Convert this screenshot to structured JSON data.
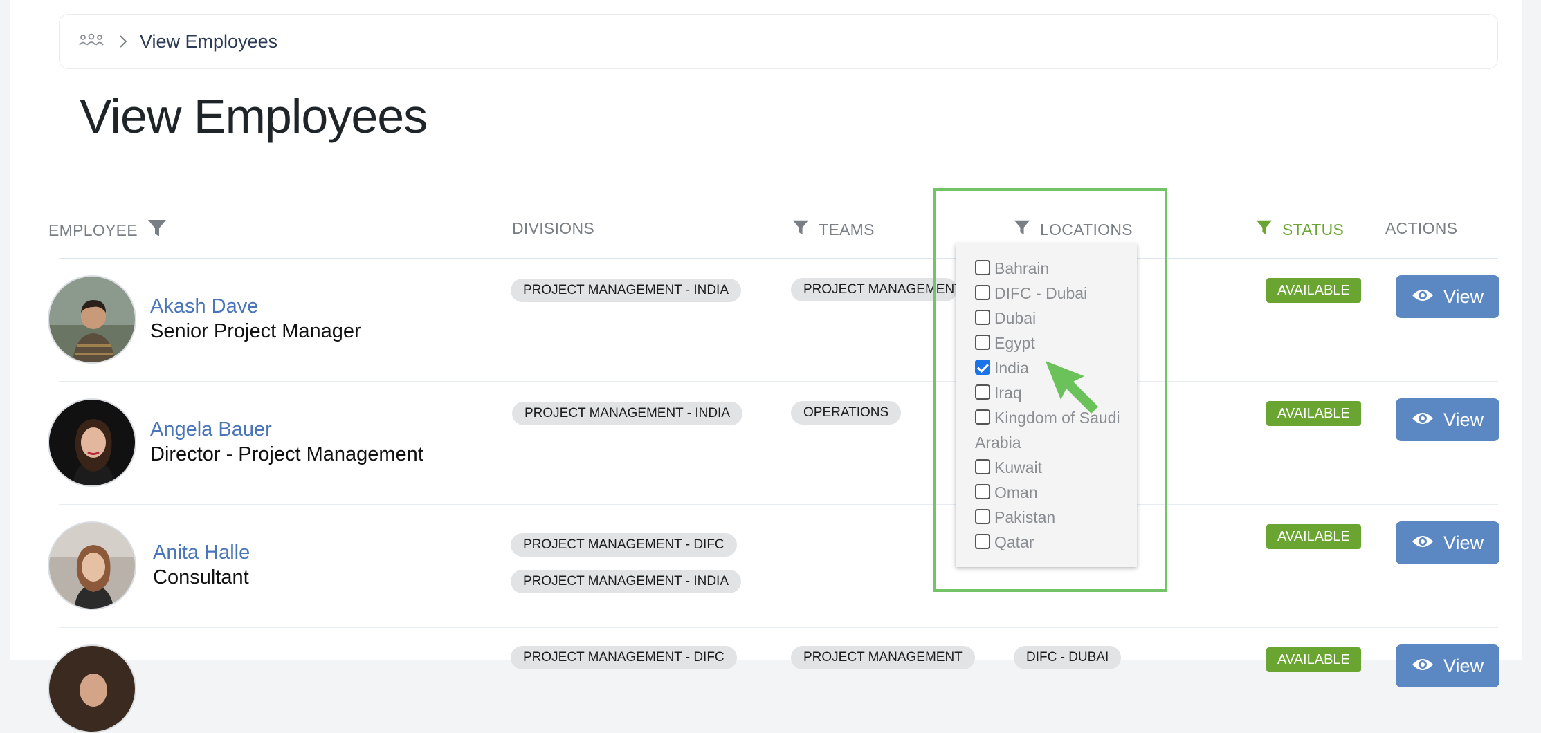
{
  "breadcrumb": {
    "current": "View Employees"
  },
  "page": {
    "title": "View Employees"
  },
  "columns": {
    "employee": "EMPLOYEE",
    "divisions": "DIVISIONS",
    "teams": "TEAMS",
    "locations": "LOCATIONS",
    "status": "STATUS",
    "actions": "ACTIONS"
  },
  "employees": [
    {
      "name": "Akash Dave",
      "title": "Senior Project Manager",
      "divisions": [
        "PROJECT MANAGEMENT - INDIA"
      ],
      "teams": [
        "PROJECT MANAGEMENT"
      ],
      "status": "AVAILABLE",
      "action": "View"
    },
    {
      "name": "Angela Bauer",
      "title": "Director - Project Management",
      "divisions": [
        "PROJECT MANAGEMENT - INDIA"
      ],
      "teams": [
        "OPERATIONS"
      ],
      "status": "AVAILABLE",
      "action": "View"
    },
    {
      "name": "Anita Halle",
      "title": "Consultant",
      "divisions": [
        "PROJECT MANAGEMENT - DIFC",
        "PROJECT MANAGEMENT - INDIA"
      ],
      "teams": [],
      "status": "AVAILABLE",
      "action": "View"
    },
    {
      "divisions": [
        "PROJECT MANAGEMENT - DIFC"
      ],
      "teams": [
        "PROJECT MANAGEMENT"
      ],
      "locations": [
        "DIFC - DUBAI"
      ],
      "status": "AVAILABLE",
      "action": "View"
    }
  ],
  "location_filter": {
    "options": [
      {
        "label": "Bahrain",
        "checked": false
      },
      {
        "label": "DIFC - Dubai",
        "checked": false
      },
      {
        "label": "Dubai",
        "checked": false
      },
      {
        "label": "Egypt",
        "checked": false
      },
      {
        "label": "India",
        "checked": true
      },
      {
        "label": "Iraq",
        "checked": false
      },
      {
        "label": "Kingdom of Saudi Arabia",
        "checked": false
      },
      {
        "label": "Kuwait",
        "checked": false
      },
      {
        "label": "Oman",
        "checked": false
      },
      {
        "label": "Pakistan",
        "checked": false
      },
      {
        "label": "Qatar",
        "checked": false
      }
    ]
  },
  "colors": {
    "accent_green": "#6aa532",
    "link_blue": "#4a76b8",
    "button_blue": "#5b87c3",
    "highlight_green": "#72c466"
  },
  "icons": {
    "breadcrumb": "people-group-icon",
    "separator": "chevron-right-icon",
    "filter": "funnel-filter-icon",
    "view": "eye-icon",
    "cursor": "arrow-cursor-icon"
  }
}
